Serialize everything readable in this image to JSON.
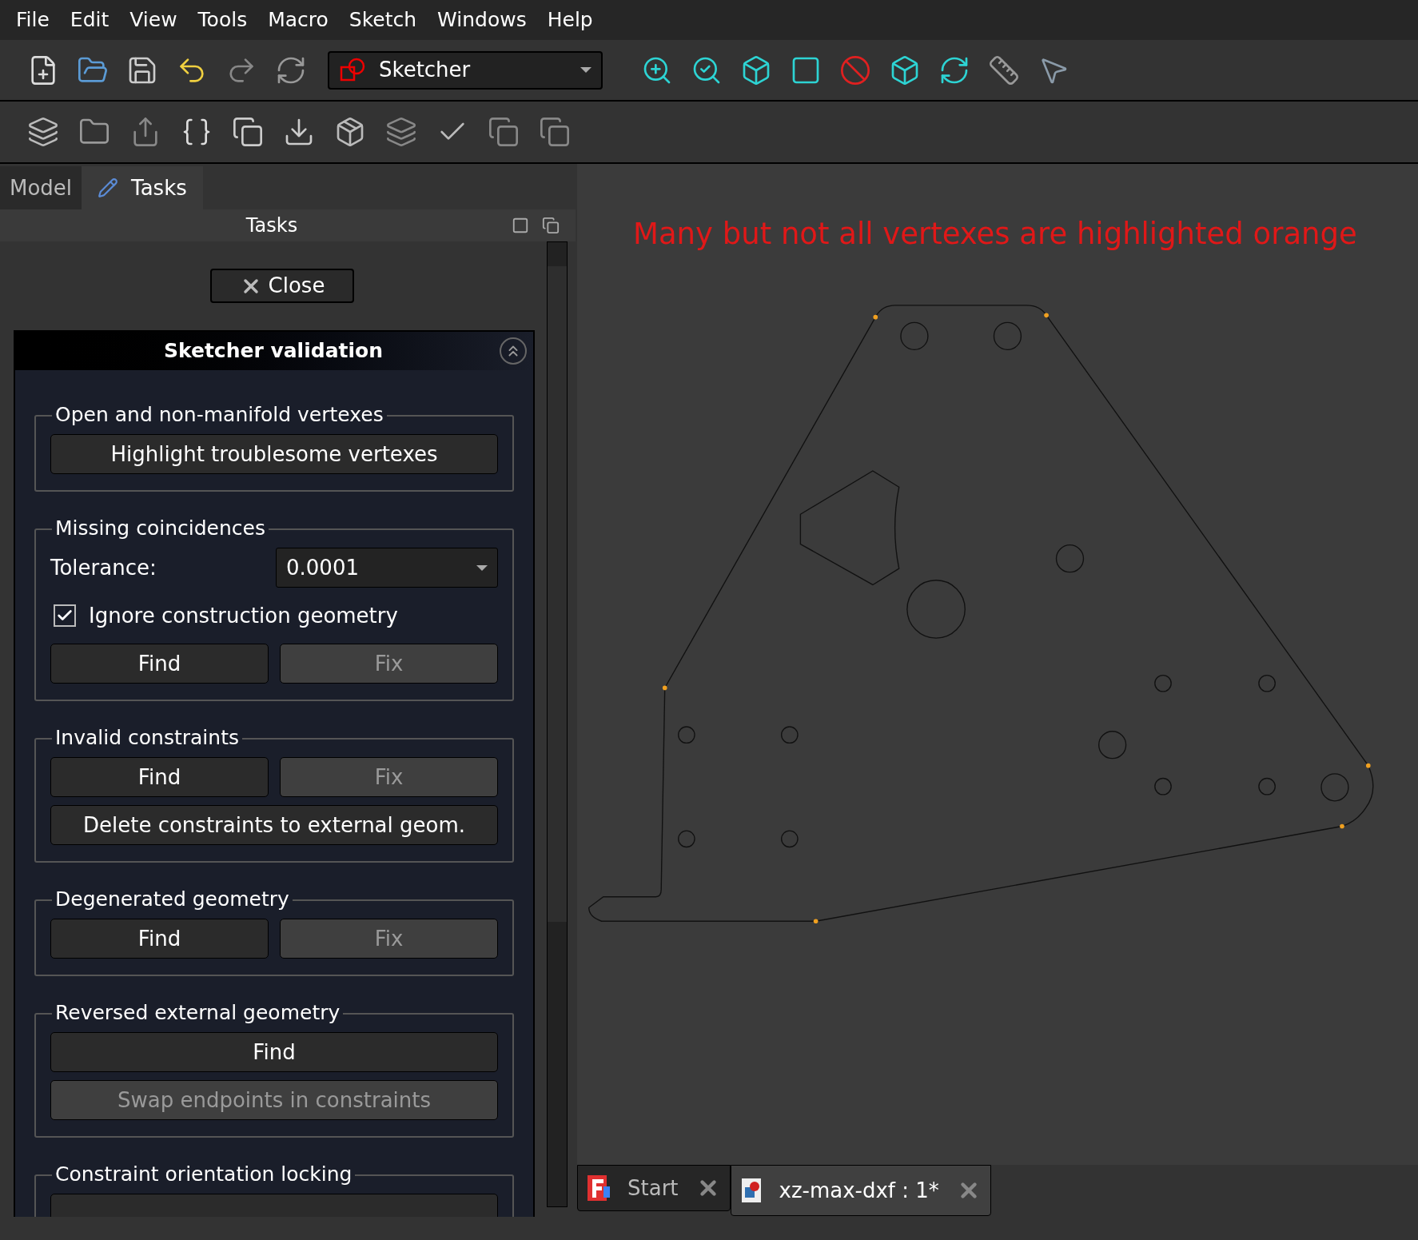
{
  "menu": [
    "File",
    "Edit",
    "View",
    "Tools",
    "Macro",
    "Sketch",
    "Windows",
    "Help"
  ],
  "workbench": {
    "value": "Sketcher"
  },
  "panel_tabs": [
    {
      "label": "Model",
      "selected": false
    },
    {
      "label": "Tasks",
      "selected": true
    }
  ],
  "panel_title": "Tasks",
  "close_button": "Close",
  "section": {
    "title": "Sketcher validation",
    "expanded": true,
    "groups": [
      {
        "title": "Open and non-manifold vertexes",
        "rows": [
          {
            "kind": "buttons",
            "buttons": [
              {
                "label": "Highlight troublesome vertexes",
                "disabled": false
              }
            ]
          }
        ]
      },
      {
        "title": "Missing coincidences",
        "rows": [
          {
            "kind": "combo",
            "label": "Tolerance:",
            "value": "0.0001"
          },
          {
            "kind": "checkbox",
            "label": "Ignore construction geometry",
            "checked": true
          },
          {
            "kind": "buttons",
            "buttons": [
              {
                "label": "Find",
                "disabled": false
              },
              {
                "label": "Fix",
                "disabled": true
              }
            ]
          }
        ]
      },
      {
        "title": "Invalid constraints",
        "rows": [
          {
            "kind": "buttons",
            "buttons": [
              {
                "label": "Find",
                "disabled": false
              },
              {
                "label": "Fix",
                "disabled": true
              }
            ]
          },
          {
            "kind": "buttons",
            "buttons": [
              {
                "label": "Delete constraints to external geom.",
                "disabled": false
              }
            ]
          }
        ]
      },
      {
        "title": "Degenerated geometry",
        "rows": [
          {
            "kind": "buttons",
            "buttons": [
              {
                "label": "Find",
                "disabled": false
              },
              {
                "label": "Fix",
                "disabled": true
              }
            ]
          }
        ]
      },
      {
        "title": "Reversed external geometry",
        "rows": [
          {
            "kind": "buttons",
            "buttons": [
              {
                "label": "Find",
                "disabled": false
              }
            ]
          },
          {
            "kind": "buttons",
            "buttons": [
              {
                "label": "Swap endpoints in constraints",
                "disabled": true
              }
            ]
          }
        ]
      },
      {
        "title": "Constraint orientation locking"
      }
    ]
  },
  "canvas": {
    "annotation": "Many but not all vertexes are highlighted orange"
  },
  "doc_tabs": [
    {
      "label": "Start",
      "kind": "start",
      "selected": false
    },
    {
      "label": "xz-max-dxf : 1*",
      "kind": "document",
      "selected": true
    }
  ]
}
